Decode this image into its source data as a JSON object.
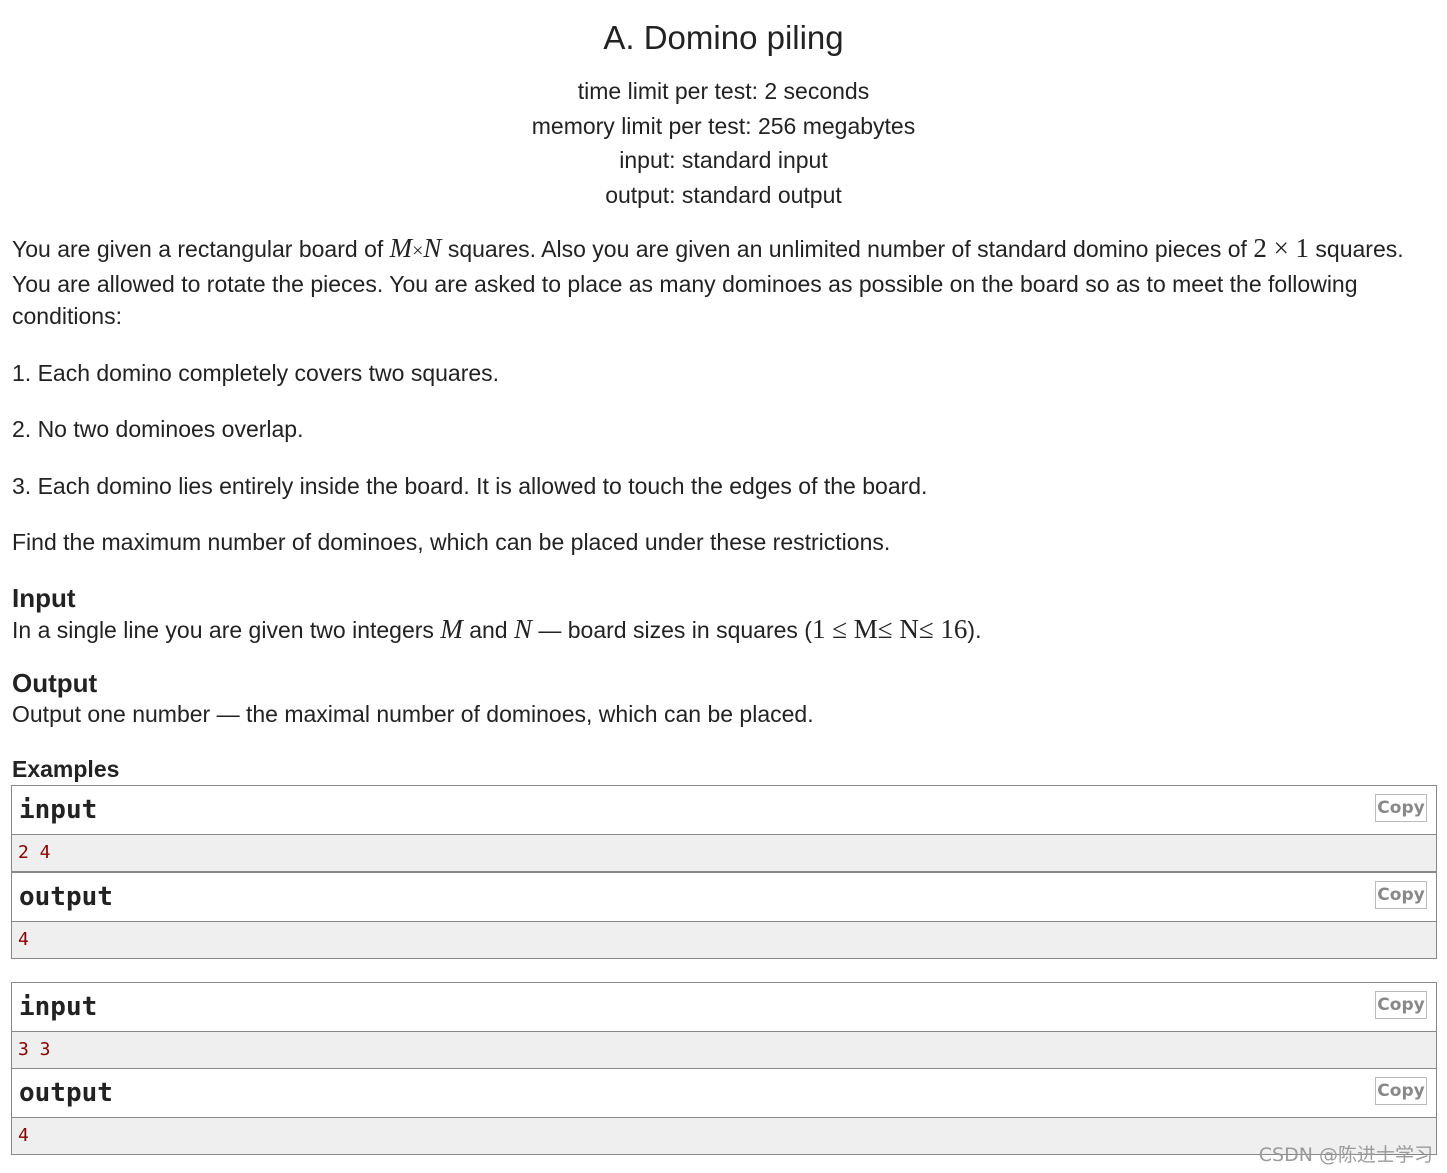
{
  "problem": {
    "title": "A. Domino piling",
    "limits": [
      "time limit per test: 2 seconds",
      "memory limit per test: 256 megabytes",
      "input: standard input",
      "output: standard output"
    ]
  },
  "statement": {
    "intro_a": "You are given a rectangular board of ",
    "intro_math_1": {
      "m": "M",
      "times": "×",
      "n": "N"
    },
    "intro_b": " squares. Also you are given an unlimited number of standard domino pieces of ",
    "intro_math_2": "2 × 1",
    "intro_c": " squares. You are allowed to rotate the pieces. You are asked to place as many dominoes as possible on the board so as to meet the following conditions:",
    "conditions": [
      "1. Each domino completely covers two squares.",
      "2. No two dominoes overlap.",
      "3. Each domino lies entirely inside the board. It is allowed to touch the edges of the board."
    ],
    "task": "Find the maximum number of dominoes, which can be placed under these restrictions."
  },
  "input_section": {
    "title": "Input",
    "text_a": "In a single line you are given two integers ",
    "m": "M",
    "text_b": " and ",
    "n": "N",
    "text_c": " — board sizes in squares (",
    "constraint": "1 ≤ M≤ N≤ 16",
    "text_d": ")."
  },
  "output_section": {
    "title": "Output",
    "text": "Output one number — the maximal number of dominoes, which can be placed."
  },
  "examples": {
    "title": "Examples",
    "copy_label": "Copy",
    "input_label": "input",
    "output_label": "output",
    "tests": [
      {
        "input": "2 4",
        "output": "4"
      },
      {
        "input": "3 3",
        "output": "4"
      }
    ]
  },
  "watermark": "CSDN @陈进士学习"
}
